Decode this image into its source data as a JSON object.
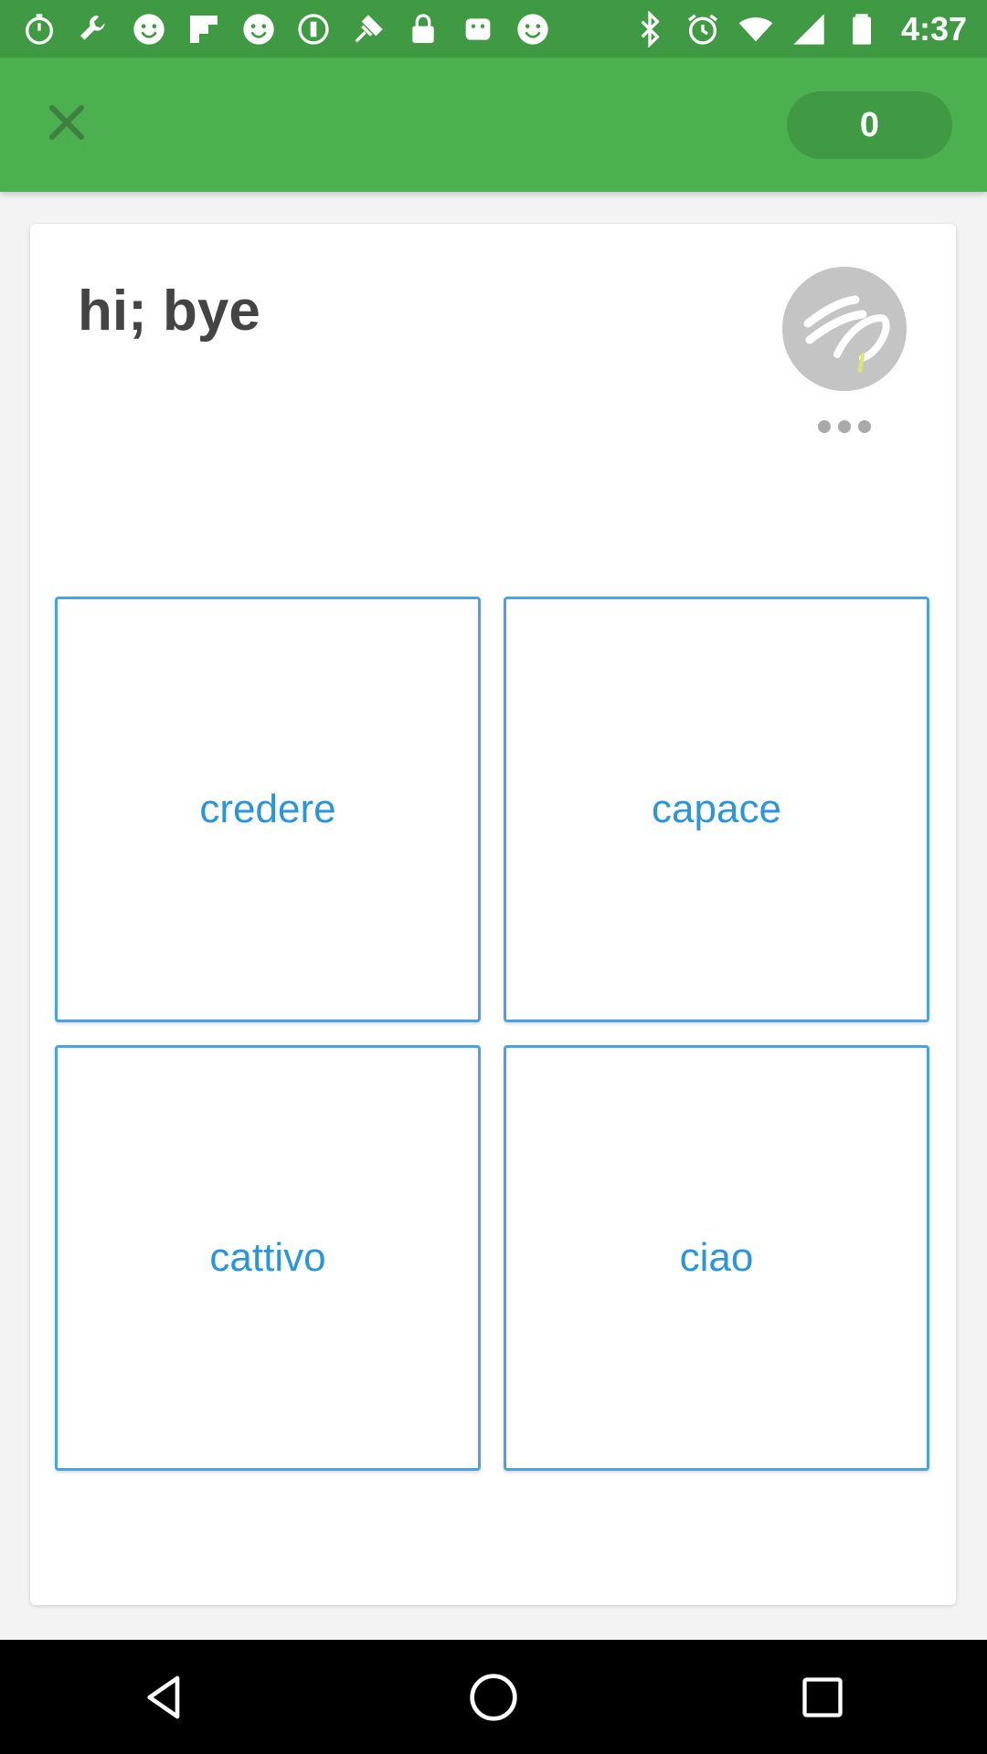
{
  "status_bar": {
    "time": "4:37",
    "left_icons": [
      "stopwatch-icon",
      "wrench-icon",
      "smiley-icon",
      "flipboard-icon",
      "smiley-icon",
      "record-icon",
      "fake-gps-icon",
      "lock-icon",
      "android-icon",
      "smiley-icon"
    ],
    "right_icons": [
      "bluetooth-icon",
      "alarm-icon",
      "wifi-icon",
      "signal-icon",
      "battery-icon"
    ]
  },
  "app_bar": {
    "close_icon": "close-icon",
    "score": "0"
  },
  "question": {
    "prompt": "hi; bye",
    "more_icon": "more-dots-icon"
  },
  "options": [
    {
      "label": "credere"
    },
    {
      "label": "capace"
    },
    {
      "label": "cattivo"
    },
    {
      "label": "ciao"
    }
  ],
  "colors": {
    "status_bar": "#3f9a43",
    "app_bar": "#4caf50",
    "option_border": "#4aa3df",
    "option_text": "#2b95dc"
  },
  "nav_bar": {
    "back_icon": "back-triangle-icon",
    "home_icon": "home-circle-icon",
    "recents_icon": "recents-square-icon"
  }
}
